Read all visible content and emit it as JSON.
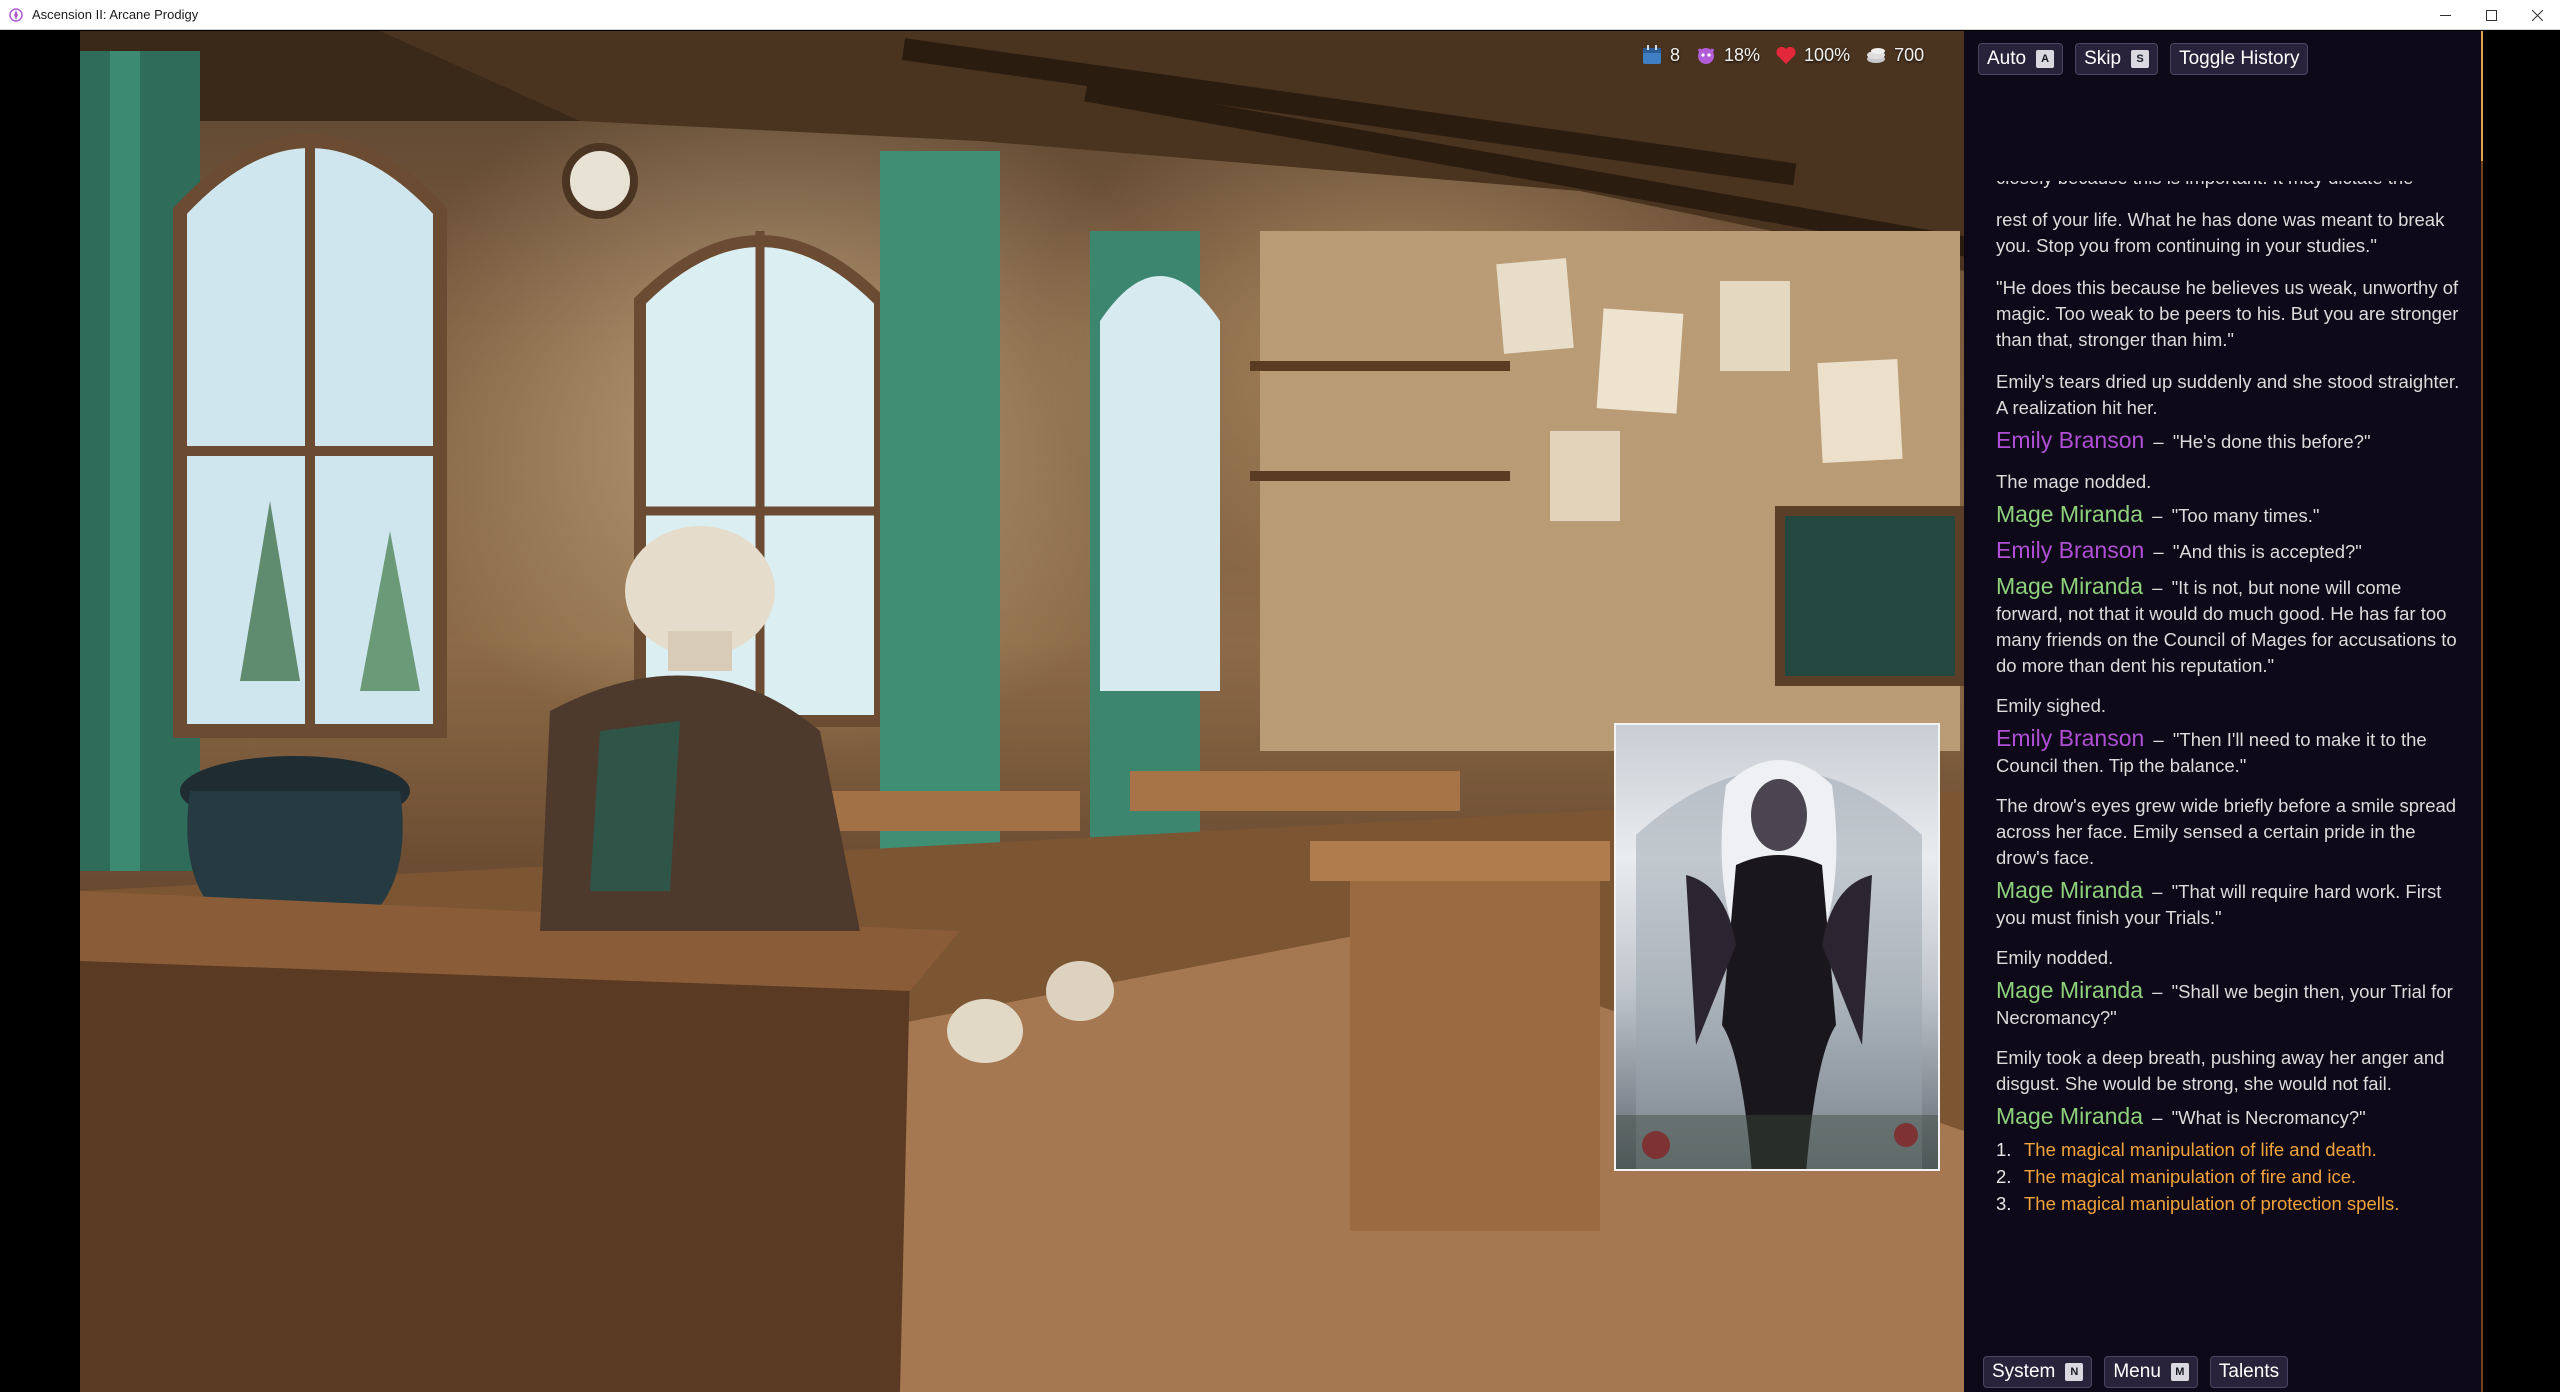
{
  "window": {
    "title": "Ascension II: Arcane Prodigy",
    "controls": [
      "minimize-icon",
      "maximize-icon",
      "close-icon"
    ]
  },
  "hud": {
    "days": "8",
    "corruption": "18%",
    "health": "100%",
    "gold": "700"
  },
  "top_buttons": {
    "auto": {
      "label": "Auto",
      "key": "A"
    },
    "skip": {
      "label": "Skip",
      "key": "S"
    },
    "history": {
      "label": "Toggle History"
    }
  },
  "bottom_buttons": {
    "system": {
      "label": "System",
      "key": "N"
    },
    "menu": {
      "label": "Menu",
      "key": "M"
    },
    "talents": {
      "label": "Talents"
    }
  },
  "history": {
    "clipped_line": "closely because this is important. It may dictate the",
    "p1": "rest of your life. What he has done was meant to break you. Stop you from continuing in your studies.\"",
    "p2": "\"He does this because he believes us weak, unworthy of magic. Too weak to be peers to his. But you are stronger than that, stronger than him.\"",
    "p3": "Emily's tears dried up suddenly and she stood straighter. A realization hit her.",
    "emily1_speaker": "Emily Branson",
    "emily1": "\"He's done this before?\"",
    "p4": "The mage nodded.",
    "mage1_speaker": "Mage Miranda",
    "mage1": "\"Too many times.\"",
    "emily2_speaker": "Emily Branson",
    "emily2": "\"And this is accepted?\"",
    "mage2_speaker": "Mage Miranda",
    "mage2": "\"It is not, but none will come forward, not that it would do much good. He has far too many friends on the Council of Mages for accusations to do more than dent his reputation.\"",
    "p5": "Emily sighed.",
    "emily3_speaker": "Emily Branson",
    "emily3": "\"Then I'll need to make it to the Council then. Tip the balance.\"",
    "p6": "The drow's eyes grew wide briefly before a smile spread across her face. Emily sensed a certain pride in the drow's face.",
    "mage3_speaker": "Mage Miranda",
    "mage3": "\"That will require hard work. First you must finish your Trials.\"",
    "p7": "Emily nodded.",
    "mage4_speaker": "Mage Miranda",
    "mage4": "\"Shall we begin then, your Trial for Necromancy?\"",
    "p8": "Emily took a deep breath, pushing away her anger and disgust. She would be strong, she would not fail.",
    "mage5_speaker": "Mage Miranda",
    "mage5": "\"What is Necromancy?\"",
    "dash": "–",
    "choices": [
      {
        "num": "1.",
        "text": "The magical manipulation of life and death."
      },
      {
        "num": "2.",
        "text": "The magical manipulation of fire and ice."
      },
      {
        "num": "3.",
        "text": "The magical manipulation of protection spells."
      }
    ]
  },
  "colors": {
    "emily": "#b04fd6",
    "mage": "#8ed17b",
    "choice": "#f2a33a",
    "panel_bg": "#0d0918",
    "accent_edge": "#d27a2c"
  }
}
